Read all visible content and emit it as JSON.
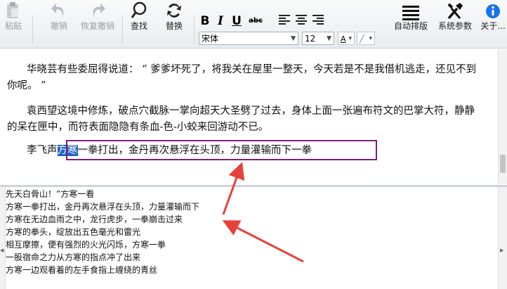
{
  "toolbar": {
    "paste": "粘贴",
    "undo": "撤销",
    "redo": "恢复撤销",
    "find": "查找",
    "replace": "替换",
    "bold": "B",
    "italic": "I",
    "underline": "U",
    "strike": "abc",
    "font_name": "宋体",
    "font_size": "12",
    "auto_layout": "自动排版",
    "sys_params": "系统参数",
    "about": "关于..."
  },
  "editor": {
    "paragraphs": [
      "华晓芸有些委屈得说道：  “ 爹爹坏死了，将我关在屋里一整天，今天若是不是我借机逃走，还见不到你呢。  ”",
      "袁西望这境中修炼，破点穴截脉一掌向超天大圣劈了过去，身体上面一张遍布符文的巴掌大符，静静的呆在匣中，而符表面隐隐有条血-色-小蛟来回游动不已。"
    ],
    "last_prefix": "李飞声",
    "last_selected": "方寒",
    "last_rest": "一拳打出，金丹再次悬浮在头顶，力量灌输而下一拳"
  },
  "suggestions": [
    "先天白骨山！”方寒一看",
    "方寒一拳打出，金丹再次悬浮在头顶，力量灌输而下",
    "方寒在无边血雨之中，龙行虎步，一拳崩击过来",
    "方寒的拳头，绽放出五色毫光和雷光",
    "相互摩擦，便有强烈的火光闪烁，方寒一拳",
    "一股宿命之力从方寒的指点冲了出来",
    "方寒一边观看着的左手食指上缠绕的青丝"
  ],
  "colors": {
    "highlight": "#1e64c8",
    "box": "#7b1f7a",
    "arrow": "#e8413b"
  }
}
